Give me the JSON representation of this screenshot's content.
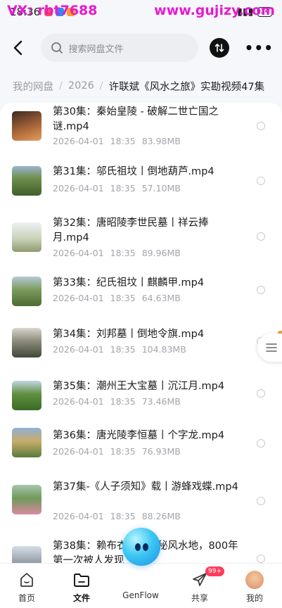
{
  "watermark": {
    "left": "VX: rbt7688",
    "right": "www.gujizy.com"
  },
  "status": {
    "time": "18:36",
    "battery": "34"
  },
  "header": {
    "search_placeholder": "搜索网盘文件"
  },
  "breadcrumb": {
    "items": [
      "我的网盘",
      "2026"
    ],
    "current": "许联斌《风水之旅》实勘视频47集"
  },
  "files": [
    {
      "name": "第30集：秦始皇陵 - 破解二世亡国之谜.mp4",
      "date": "2026-04-01",
      "time": "18:35",
      "size": "83.98MB"
    },
    {
      "name": "第31集：邬氏祖坟丨倒地葫芦.mp4",
      "date": "2026-04-01",
      "time": "18:35",
      "size": "57.10MB"
    },
    {
      "name": "第32集：唐昭陵李世民墓丨祥云捧月.mp4",
      "date": "2026-04-01",
      "time": "18:35",
      "size": "89.96MB"
    },
    {
      "name": "第33集：纪氏祖坟丨麒麟甲.mp4",
      "date": "2026-04-01",
      "time": "18:35",
      "size": "64.63MB"
    },
    {
      "name": "第34集：刘邦墓丨倒地令旗.mp4",
      "date": "2026-04-01",
      "time": "18:35",
      "size": "104.83MB"
    },
    {
      "name": "第35集：潮州王大宝墓丨沉江月.mp4",
      "date": "2026-04-01",
      "time": "18:35",
      "size": "73.46MB"
    },
    {
      "name": "第36集：唐光陵李恒墓丨个字龙.mp4",
      "date": "2026-04-01",
      "time": "18:35",
      "size": "76.93MB"
    },
    {
      "name": "第37集-《人子须知》载丨游蜂戏蝶.mp4",
      "date": "2026-04-01",
      "time": "18:35",
      "size": "88.26MB"
    },
    {
      "name": "第38集：赖布衣点的神秘风水地，800年第一次被人发现",
      "date": "",
      "time": "",
      "size": ""
    }
  ],
  "nav": {
    "items": [
      {
        "label": "首页",
        "icon": "home-icon"
      },
      {
        "label": "文件",
        "icon": "folder-icon"
      },
      {
        "label": "GenFlow",
        "icon": "genflow-orb"
      },
      {
        "label": "共享",
        "icon": "share-icon"
      },
      {
        "label": "我的",
        "icon": "avatar"
      }
    ],
    "share_badge": "99+"
  },
  "colors": {
    "accent": "#e61ad1",
    "badge": "#ff3b5c"
  }
}
